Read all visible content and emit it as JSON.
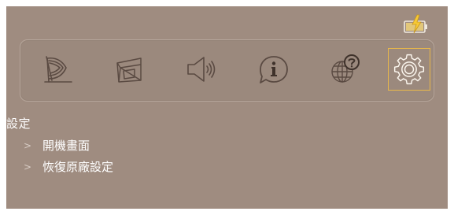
{
  "status": {
    "battery_icon": "battery-charging-icon",
    "accent_color": "#f2c443"
  },
  "toolbar": {
    "icons": [
      {
        "name": "display-mode-icon",
        "selected": false
      },
      {
        "name": "perspective-icon",
        "selected": false
      },
      {
        "name": "sound-icon",
        "selected": false
      },
      {
        "name": "info-icon",
        "selected": false
      },
      {
        "name": "language-icon",
        "selected": false
      },
      {
        "name": "settings-gear-icon",
        "selected": true
      }
    ],
    "selected_border_color": "#e9b84a"
  },
  "menu": {
    "title": "設定",
    "items": [
      {
        "label": "開機畫面",
        "bullet": ">"
      },
      {
        "label": "恢復原廠設定",
        "bullet": ">"
      }
    ]
  },
  "colors": {
    "background": "#9f8c80",
    "text": "#ffffff",
    "icon_stroke": "#5a4a42"
  }
}
